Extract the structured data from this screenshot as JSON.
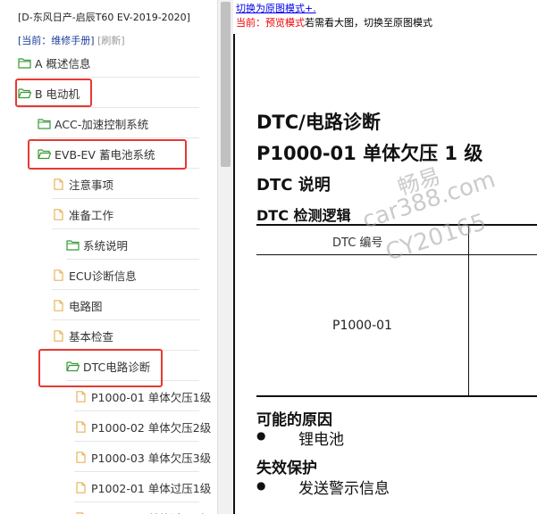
{
  "sidebar": {
    "title": "[D-东风日产-启辰T60 EV-2019-2020]",
    "current_label": "[当前：维修手册]",
    "refresh_label": "[刷新]",
    "items": [
      {
        "label": "A 概述信息",
        "icon": "folder-icon"
      },
      {
        "label": "B 电动机",
        "icon": "folder-open-icon"
      },
      {
        "label": "ACC-加速控制系统",
        "icon": "folder-icon"
      },
      {
        "label": "EVB-EV 蓄电池系统",
        "icon": "folder-open-icon"
      },
      {
        "label": "注意事项",
        "icon": "document-icon"
      },
      {
        "label": "准备工作",
        "icon": "document-icon"
      },
      {
        "label": "系统说明",
        "icon": "folder-icon"
      },
      {
        "label": "ECU诊断信息",
        "icon": "document-icon"
      },
      {
        "label": "电路图",
        "icon": "document-icon"
      },
      {
        "label": "基本检查",
        "icon": "document-icon"
      },
      {
        "label": "DTC电路诊断",
        "icon": "folder-open-icon"
      },
      {
        "label": "P1000-01 单体欠压1级",
        "icon": "document-icon"
      },
      {
        "label": "P1000-02 单体欠压2级",
        "icon": "document-icon"
      },
      {
        "label": "P1000-03 单体欠压3级",
        "icon": "document-icon"
      },
      {
        "label": "P1002-01 单体过压1级",
        "icon": "document-icon"
      },
      {
        "label": "P1002-02 单体过压2级",
        "icon": "document-icon"
      }
    ]
  },
  "main": {
    "mode_link": "切换为原图模式+.",
    "mode_prefix": "当前：",
    "mode_name": "预览模式",
    "mode_hint": "若需看大图，切换至原图模式",
    "doc": {
      "h1": "DTC/电路诊断",
      "h2": "P1000-01 单体欠压 1 级",
      "h3": "DTC 说明",
      "h4": "DTC 检测逻辑",
      "table_header": "DTC 编号",
      "table_cell": "P1000-01",
      "causes_title": "可能的原因",
      "cause_1": "锂电池",
      "failsafe_title": "失效保护",
      "failsafe_1": "发送警示信息",
      "bullet": "●"
    },
    "watermark": {
      "line1": "畅易",
      "line2": "car388.com",
      "line3": "CY20165"
    }
  },
  "colors": {
    "highlight": "#e53935",
    "link": "#0000ee",
    "mode_red": "#e00",
    "current_blue": "#1a3d99"
  }
}
